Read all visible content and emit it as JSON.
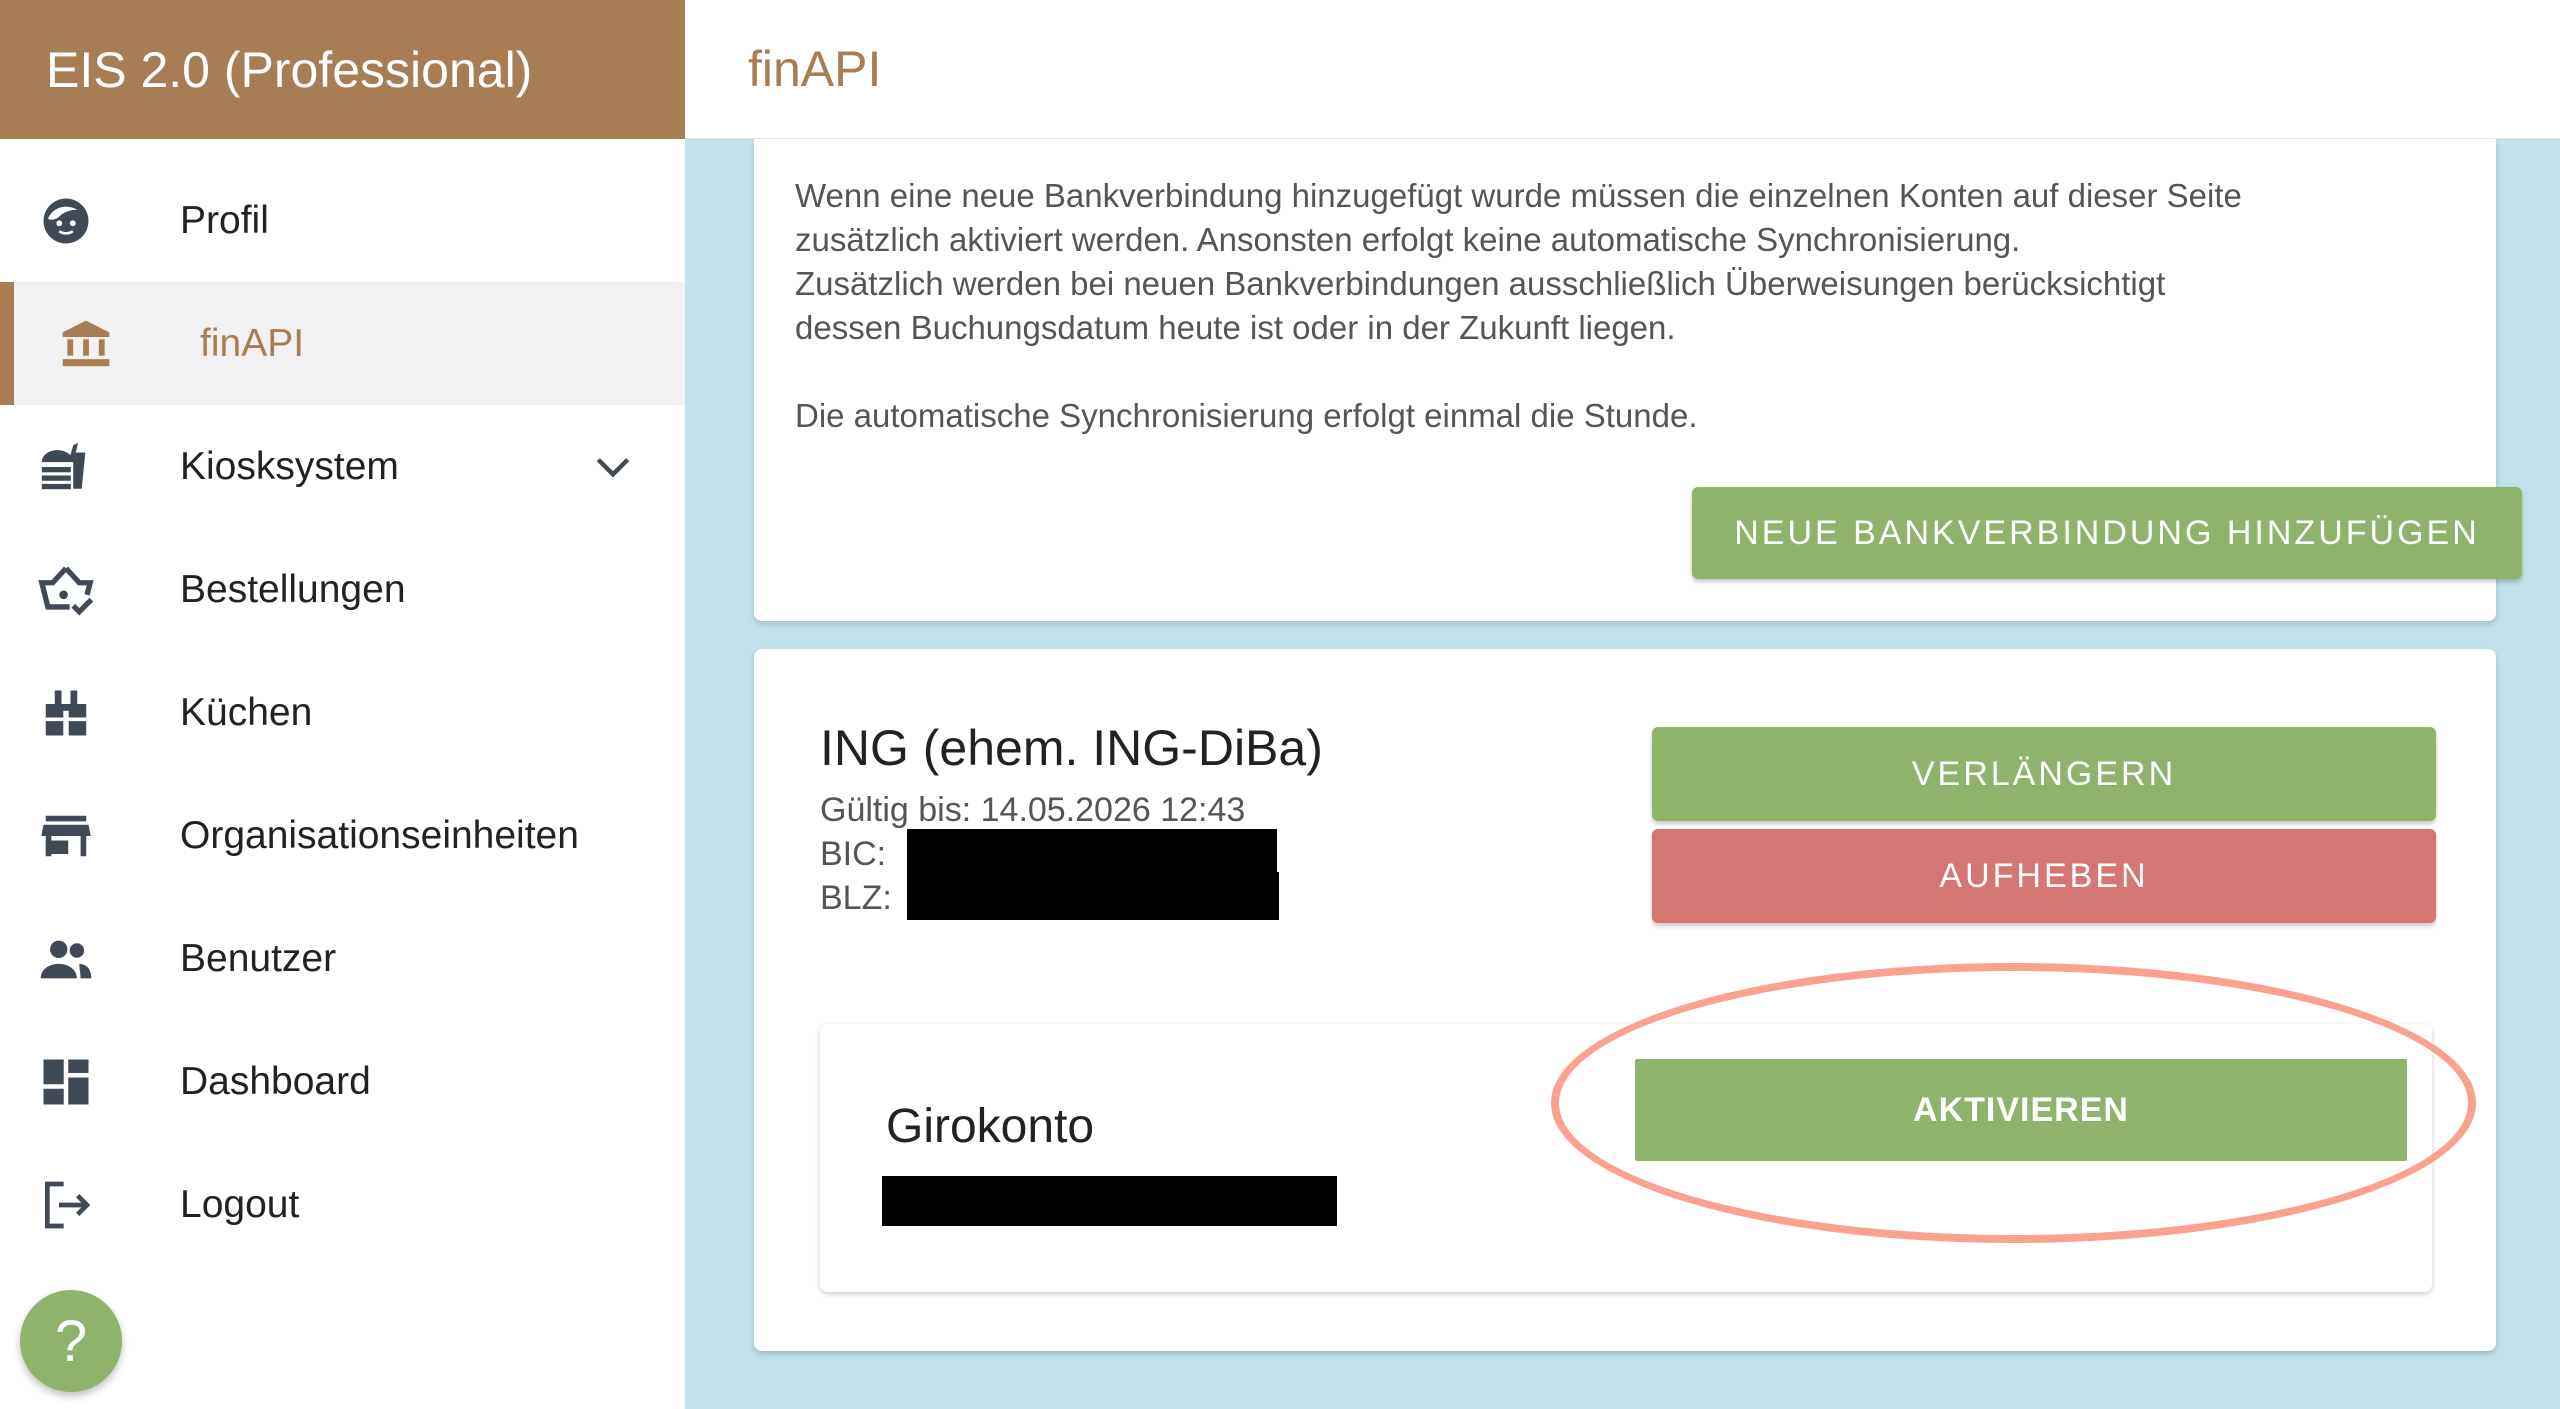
{
  "app": {
    "title": "EIS 2.0 (Professional)"
  },
  "header": {
    "title": "finAPI"
  },
  "sidebar": {
    "items": [
      {
        "label": "Profil",
        "icon": "face-icon"
      },
      {
        "label": "finAPI",
        "icon": "bank-icon",
        "active": true
      },
      {
        "label": "Kiosksystem",
        "icon": "fastfood-icon",
        "expandable": true
      },
      {
        "label": "Bestellungen",
        "icon": "basket-check-icon"
      },
      {
        "label": "Küchen",
        "icon": "kitchen-icon"
      },
      {
        "label": "Organisationseinheiten",
        "icon": "store-icon"
      },
      {
        "label": "Benutzer",
        "icon": "people-icon"
      },
      {
        "label": "Dashboard",
        "icon": "dashboard-icon"
      },
      {
        "label": "Logout",
        "icon": "logout-icon"
      }
    ],
    "help": "?"
  },
  "info": {
    "paragraph1": [
      "Wenn eine neue Bankverbindung hinzugefügt wurde müssen die einzelnen Konten auf dieser Seite",
      "zusätzlich aktiviert werden. Ansonsten erfolgt keine automatische Synchronisierung.",
      "Zusätzlich werden bei neuen Bankverbindungen ausschließlich Überweisungen berücksichtigt",
      "dessen Buchungsdatum heute ist oder in der Zukunft liegen."
    ],
    "paragraph2": "Die automatische Synchronisierung erfolgt einmal die Stunde.",
    "add_button": "NEUE BANKVERBINDUNG HINZUFÜGEN"
  },
  "bank": {
    "name": "ING (ehem. ING-DiBa)",
    "valid_until": "Gültig bis: 14.05.2026 12:43",
    "bic_label": "BIC:",
    "blz_label": "BLZ:",
    "extend_button": "VERLÄNGERN",
    "cancel_button": "AUFHEBEN",
    "account": {
      "name": "Girokonto",
      "activate_button": "AKTIVIEREN"
    }
  },
  "colors": {
    "brand": "#a97d54",
    "green": "#8fb36a",
    "red": "#d47671",
    "background": "#c2e1ea",
    "highlight": "#fa8c78"
  }
}
